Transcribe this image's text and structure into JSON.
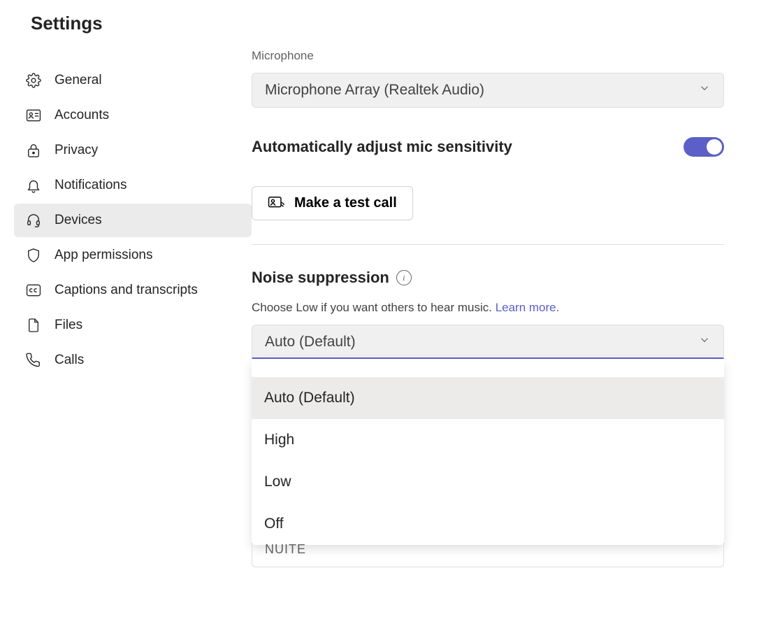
{
  "title": "Settings",
  "sidebar": {
    "items": [
      {
        "label": "General",
        "icon": "gear"
      },
      {
        "label": "Accounts",
        "icon": "id-card"
      },
      {
        "label": "Privacy",
        "icon": "lock"
      },
      {
        "label": "Notifications",
        "icon": "bell"
      },
      {
        "label": "Devices",
        "icon": "headset",
        "selected": true
      },
      {
        "label": "App permissions",
        "icon": "shield"
      },
      {
        "label": "Captions and transcripts",
        "icon": "cc"
      },
      {
        "label": "Files",
        "icon": "file"
      },
      {
        "label": "Calls",
        "icon": "phone"
      }
    ]
  },
  "main": {
    "microphone": {
      "label": "Microphone",
      "value": "Microphone Array (Realtek Audio)"
    },
    "auto_adjust": {
      "label": "Automatically adjust mic sensitivity",
      "on": true
    },
    "test_call": {
      "label": "Make a test call"
    },
    "noise": {
      "title": "Noise suppression",
      "help": "Choose Low if you want others to hear music.",
      "learn_more": "Learn more.",
      "value": "Auto (Default)",
      "options": [
        "Auto (Default)",
        "High",
        "Low",
        "Off"
      ],
      "hidden_under": "NUITE"
    }
  }
}
